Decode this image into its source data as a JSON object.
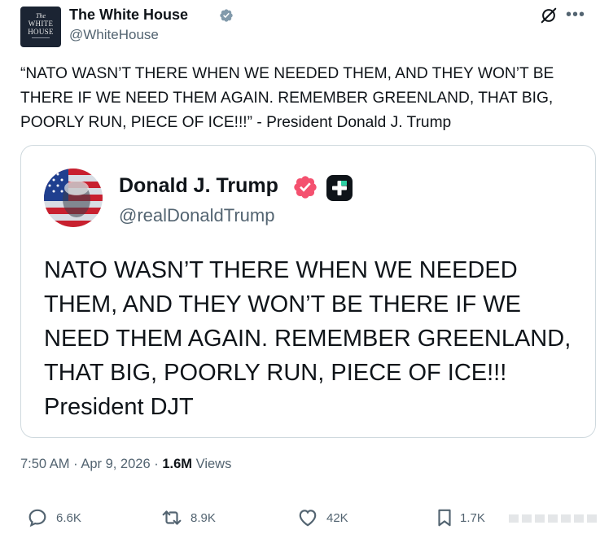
{
  "post": {
    "display_name": "The White House",
    "handle": "@WhiteHouse",
    "logo_lines": [
      "The",
      "WHITE",
      "HOUSE"
    ],
    "text": "“NATO WASN’T THERE WHEN WE NEEDED THEM, AND THEY WON’T BE THERE IF WE NEED THEM AGAIN. REMEMBER GREENLAND, THAT BIG, POORLY RUN, PIECE OF ICE!!!” - President Donald J. Trump",
    "time": "7:50 AM",
    "date": "Apr 9, 2026",
    "views_count": "1.6M",
    "views_label": "Views",
    "icons": {
      "verified": "verified-gray-badge-icon",
      "grok": "grok-icon",
      "more": "more-icon"
    }
  },
  "quoted": {
    "display_name": "Donald J. Trump",
    "handle": "@realDonaldTrump",
    "text": "NATO WASN’T THERE WHEN WE NEEDED THEM, AND THEY WON’T BE THERE IF WE NEED THEM AGAIN. REMEMBER GREENLAND, THAT BIG, POORLY RUN, PIECE OF ICE!!! President DJT",
    "icons": {
      "verified": "verified-red-badge-icon",
      "plus": "plus-app-icon"
    }
  },
  "actions": {
    "replies": "6.6K",
    "reposts": "8.9K",
    "likes": "42K",
    "bookmarks": "1.7K"
  },
  "colors": {
    "text": "#0f1419",
    "secondary": "#536471",
    "border": "#cfd9de",
    "verified_red": "#f4516f",
    "verified_gray": "#829aab"
  }
}
